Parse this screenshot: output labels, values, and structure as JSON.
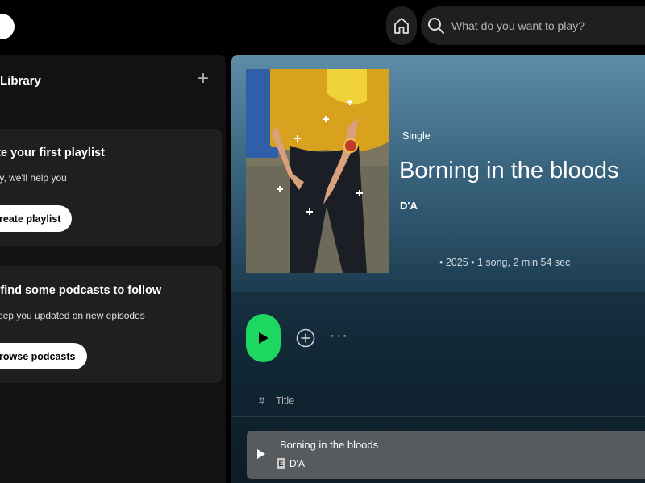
{
  "topbar": {
    "search_placeholder": "What do you want to play?"
  },
  "sidebar": {
    "title": "r Library",
    "cards": [
      {
        "title": "eate your first playlist",
        "subtitle": "easy, we'll help you",
        "button": "Create playlist"
      },
      {
        "title": "t's find some podcasts to follow",
        "subtitle": "'ll keep you updated on new episodes",
        "button": "Browse podcasts"
      }
    ]
  },
  "album": {
    "type": "Single",
    "title": "Borning in the bloods",
    "artist": "D'A",
    "info": "• 2025 • 1 song, 2 min 54 sec"
  },
  "tracklist": {
    "col_hash": "#",
    "col_title": "Title",
    "tracks": [
      {
        "name": "Borning in the bloods",
        "explicit": "E",
        "artist": "D'A"
      }
    ]
  },
  "colors": {
    "accent_green": "#1ed760",
    "header_blue": "#5e8da9",
    "background": "#000000"
  }
}
